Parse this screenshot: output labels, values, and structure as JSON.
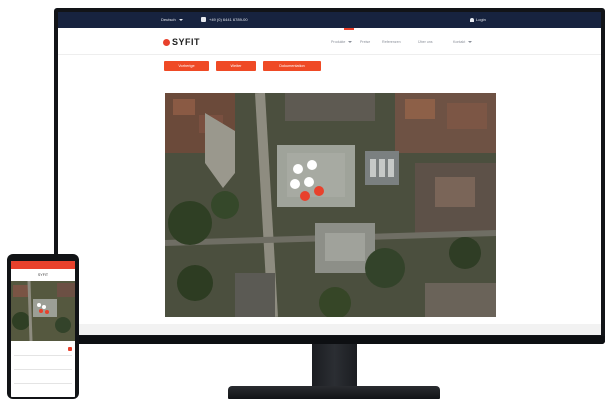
{
  "monitor": {
    "topbar": {
      "language": "Deutsch",
      "phone": "+49 (0) 6441 6789-00",
      "login": "Login"
    },
    "navbar": {
      "logo": "SYFIT",
      "menu": [
        "Produkte",
        "Preise",
        "Referenzen",
        "Über uns",
        "Kontakt"
      ]
    },
    "actions": [
      "Vorherige",
      "Weiter",
      "Dokumentation"
    ]
  },
  "phone": {
    "header": "SYFIT",
    "list": [
      "",
      "",
      ""
    ]
  },
  "colors": {
    "accent": "#ef4a25",
    "topbar": "#17233f",
    "bezel": "#121418"
  }
}
